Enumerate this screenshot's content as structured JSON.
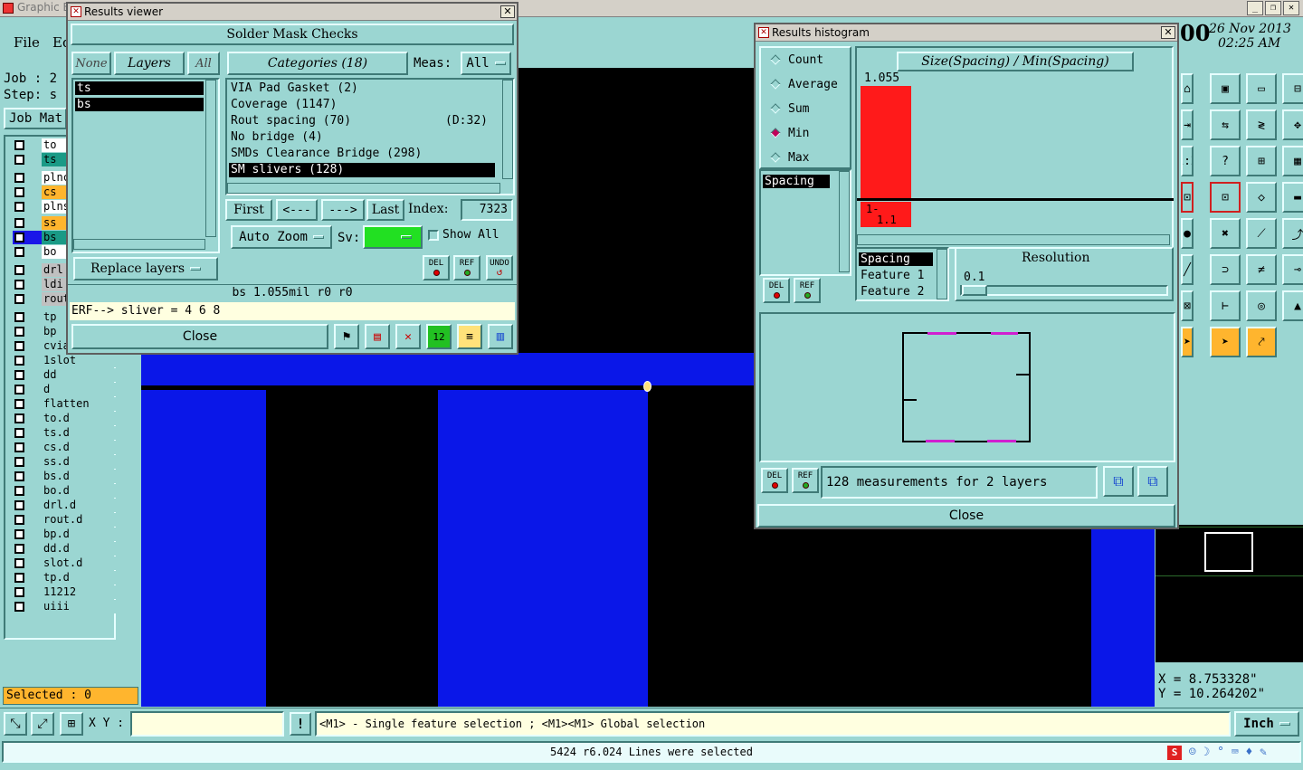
{
  "app": {
    "title_partial": "Graphic E",
    "menu": [
      "File",
      "Ed"
    ],
    "job_label": "Job : 2",
    "step_label": "Step: s",
    "job_matrix_label": "Job Mat",
    "datetime_partial": "00",
    "date": "26 Nov 2013",
    "time": "02:25 AM"
  },
  "layers": [
    {
      "name": "to",
      "color": "#ffffff"
    },
    {
      "name": "ts",
      "color": "#1a9a86"
    },
    {
      "name": "plnc",
      "color": "#ffffff"
    },
    {
      "name": "cs",
      "color": "#ffb52e"
    },
    {
      "name": "plns",
      "color": "#ffffff"
    },
    {
      "name": "ss",
      "color": "#ffb52e"
    },
    {
      "name": "bs",
      "color": "#1a9a86",
      "active": true
    },
    {
      "name": "bo",
      "color": "#ffffff"
    },
    {
      "name": "drl",
      "color": "#c0c0c0"
    },
    {
      "name": "ldi",
      "color": "#c0c0c0"
    },
    {
      "name": "rout",
      "color": "#c0c0c0"
    },
    {
      "name": "tp",
      "color": "#9bd6d2"
    },
    {
      "name": "bp",
      "color": "#9bd6d2"
    },
    {
      "name": "cvia",
      "color": "#9bd6d2"
    },
    {
      "name": "1slot",
      "color": "#9bd6d2"
    },
    {
      "name": "dd",
      "color": "#9bd6d2"
    },
    {
      "name": "d",
      "color": "#9bd6d2"
    },
    {
      "name": "flatten",
      "color": "#9bd6d2"
    },
    {
      "name": "to.d",
      "color": "#9bd6d2"
    },
    {
      "name": "ts.d",
      "color": "#9bd6d2"
    },
    {
      "name": "cs.d",
      "color": "#9bd6d2"
    },
    {
      "name": "ss.d",
      "color": "#9bd6d2"
    },
    {
      "name": "bs.d",
      "color": "#9bd6d2"
    },
    {
      "name": "bo.d",
      "color": "#9bd6d2"
    },
    {
      "name": "drl.d",
      "color": "#9bd6d2"
    },
    {
      "name": "rout.d",
      "color": "#9bd6d2"
    },
    {
      "name": "bp.d",
      "color": "#9bd6d2"
    },
    {
      "name": "dd.d",
      "color": "#9bd6d2"
    },
    {
      "name": "slot.d",
      "color": "#9bd6d2"
    },
    {
      "name": "tp.d",
      "color": "#9bd6d2"
    },
    {
      "name": "11212",
      "color": "#9bd6d2"
    },
    {
      "name": "uiii",
      "color": "#9bd6d2"
    }
  ],
  "selected_label": "Selected : 0",
  "results_viewer": {
    "window_title": "Results viewer",
    "header": "Solder Mask Checks",
    "none_btn": "None",
    "layers_btn": "Layers",
    "all_btn": "All",
    "categories_btn": "Categories (18)",
    "meas_label": "Meas:",
    "meas_value": "All",
    "layer_list": [
      "ts",
      "bs"
    ],
    "categories": [
      {
        "text": "VIA Pad Gasket (2)",
        "extra": ""
      },
      {
        "text": "Coverage (1147)",
        "extra": ""
      },
      {
        "text": "Rout spacing (70)",
        "extra": "(D:32)"
      },
      {
        "text": "No bridge (4)",
        "extra": ""
      },
      {
        "text": "SMDs Clearance Bridge (298)",
        "extra": ""
      },
      {
        "text": "SM slivers (128)",
        "extra": "",
        "selected": true
      }
    ],
    "first_btn": "First",
    "prev_btn": "<---",
    "next_btn": "--->",
    "last_btn": "Last",
    "index_label": "Index:",
    "index_value": "7323",
    "auto_zoom": "Auto Zoom",
    "sv_label": "Sv:",
    "show_all": "Show All",
    "replace_layers": "Replace layers",
    "del": "DEL",
    "ref": "REF",
    "undo": "UNDO",
    "info_line": "bs 1.055mil  r0  r0",
    "erf_line": "ERF--> sliver = 4 6 8",
    "close": "Close"
  },
  "histogram": {
    "window_title": "Results histogram",
    "modes": [
      {
        "label": "Count",
        "on": false
      },
      {
        "label": "Average",
        "on": false
      },
      {
        "label": "Sum",
        "on": false
      },
      {
        "label": "Min",
        "on": true
      },
      {
        "label": "Max",
        "on": false
      }
    ],
    "chart_title": "Size(Spacing) / Min(Spacing)",
    "bar_value_label": "1.055",
    "bar_range_label": "1-",
    "bar_range_label2": "1.1",
    "list_items": [
      "Spacing"
    ],
    "fields": [
      "Spacing",
      "Feature 1",
      "Feature 2"
    ],
    "resolution_label": "Resolution",
    "resolution_value": "0.1",
    "del": "DEL",
    "ref": "REF",
    "status": "128 measurements for 2 layers",
    "close": "Close"
  },
  "right_panel": {
    "tools": [
      "home",
      "save",
      "window",
      "panel",
      "import",
      "flip-h",
      "mirror",
      "pan",
      "ratio-1-2",
      "help",
      "grid-select",
      "grid",
      "net-select",
      "net-select-alt",
      "edit-shape",
      "measure",
      "circle",
      "pad-x",
      "connect",
      "route",
      "line",
      "arc",
      "split",
      "intersect",
      "terminal",
      "break",
      "pad-round",
      "zone",
      "pointer-orange",
      "pointer",
      "pointer-net"
    ],
    "coord_x": "X = 8.753328\"",
    "coord_y": "Y = 10.264202\""
  },
  "bottom": {
    "xy_label": "X Y :",
    "xy_value": "",
    "hint": "<M1> - Single feature selection ; <M1><M1> Global selection",
    "units": "Inch",
    "status": "5424 r6.024 Lines were selected"
  }
}
